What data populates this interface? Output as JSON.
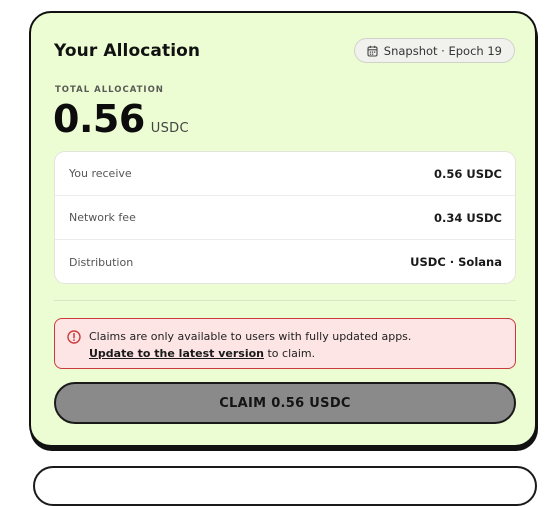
{
  "allocation": {
    "title": "Your Allocation",
    "snapshot_label": "Snapshot · Epoch 19",
    "snapshot_icon": "calendar-icon",
    "total_label": "TOTAL ALLOCATION",
    "amount": "0.56",
    "amount_unit": "USDC",
    "details": [
      {
        "label": "You receive",
        "value": "0.56 USDC"
      },
      {
        "label": "Network fee",
        "value": "0.34 USDC"
      },
      {
        "label": "Distribution",
        "value": "USDC · Solana"
      }
    ],
    "alert": {
      "icon": "alert-circle-icon",
      "message": "Claims are only available to users with fully updated apps.",
      "link_text": "Update to the latest version",
      "suffix": " to claim."
    },
    "claim_button_label": "CLAIM 0.56 USDC"
  },
  "colors": {
    "card_background": "#edfdd3",
    "alert_background": "#fde5e5",
    "alert_border": "#cc3b3b",
    "button_disabled": "#8a8a8a"
  }
}
